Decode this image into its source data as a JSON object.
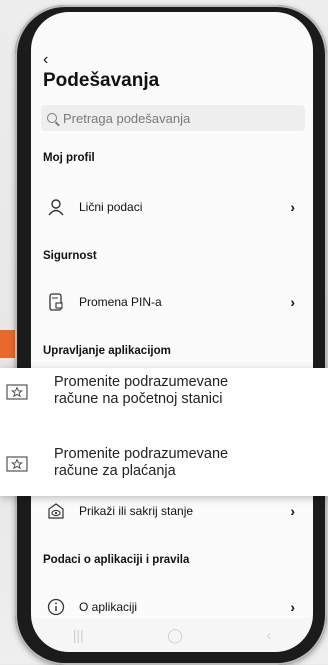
{
  "header": {
    "back_glyph": "‹",
    "title": "Podešavanja"
  },
  "search": {
    "placeholder": "Pretraga podešavanja"
  },
  "sections": {
    "profile": "Moj profil",
    "security": "Sigurnost",
    "app_management": "Upravljanje aplikacijom",
    "app_info": "Podaci o aplikaciji i pravila"
  },
  "rows": {
    "personal_data": "Lični podaci",
    "pin_change": "Promena PIN-a",
    "show_hide_balance": "Prikaži ili sakrij stanje",
    "about_app": "O aplikaciji"
  },
  "tooltips": {
    "home_accounts_line1": "Promenite podrazumevane",
    "home_accounts_line2": "račune na početnoj stanici",
    "payment_accounts_line1": "Promenite podrazumevane",
    "payment_accounts_line2": "račune za plaćanja"
  },
  "nav": {
    "recents": "|||",
    "home": "◯",
    "back": "‹"
  },
  "colors": {
    "accent_orange": "#e9692c",
    "text": "#111111",
    "search_bg": "#eeeeee"
  },
  "icons": {
    "person": "person-icon",
    "pin": "pin-card-icon",
    "eye": "eye-icon",
    "info": "info-icon",
    "star_card": "star-card-icon"
  }
}
